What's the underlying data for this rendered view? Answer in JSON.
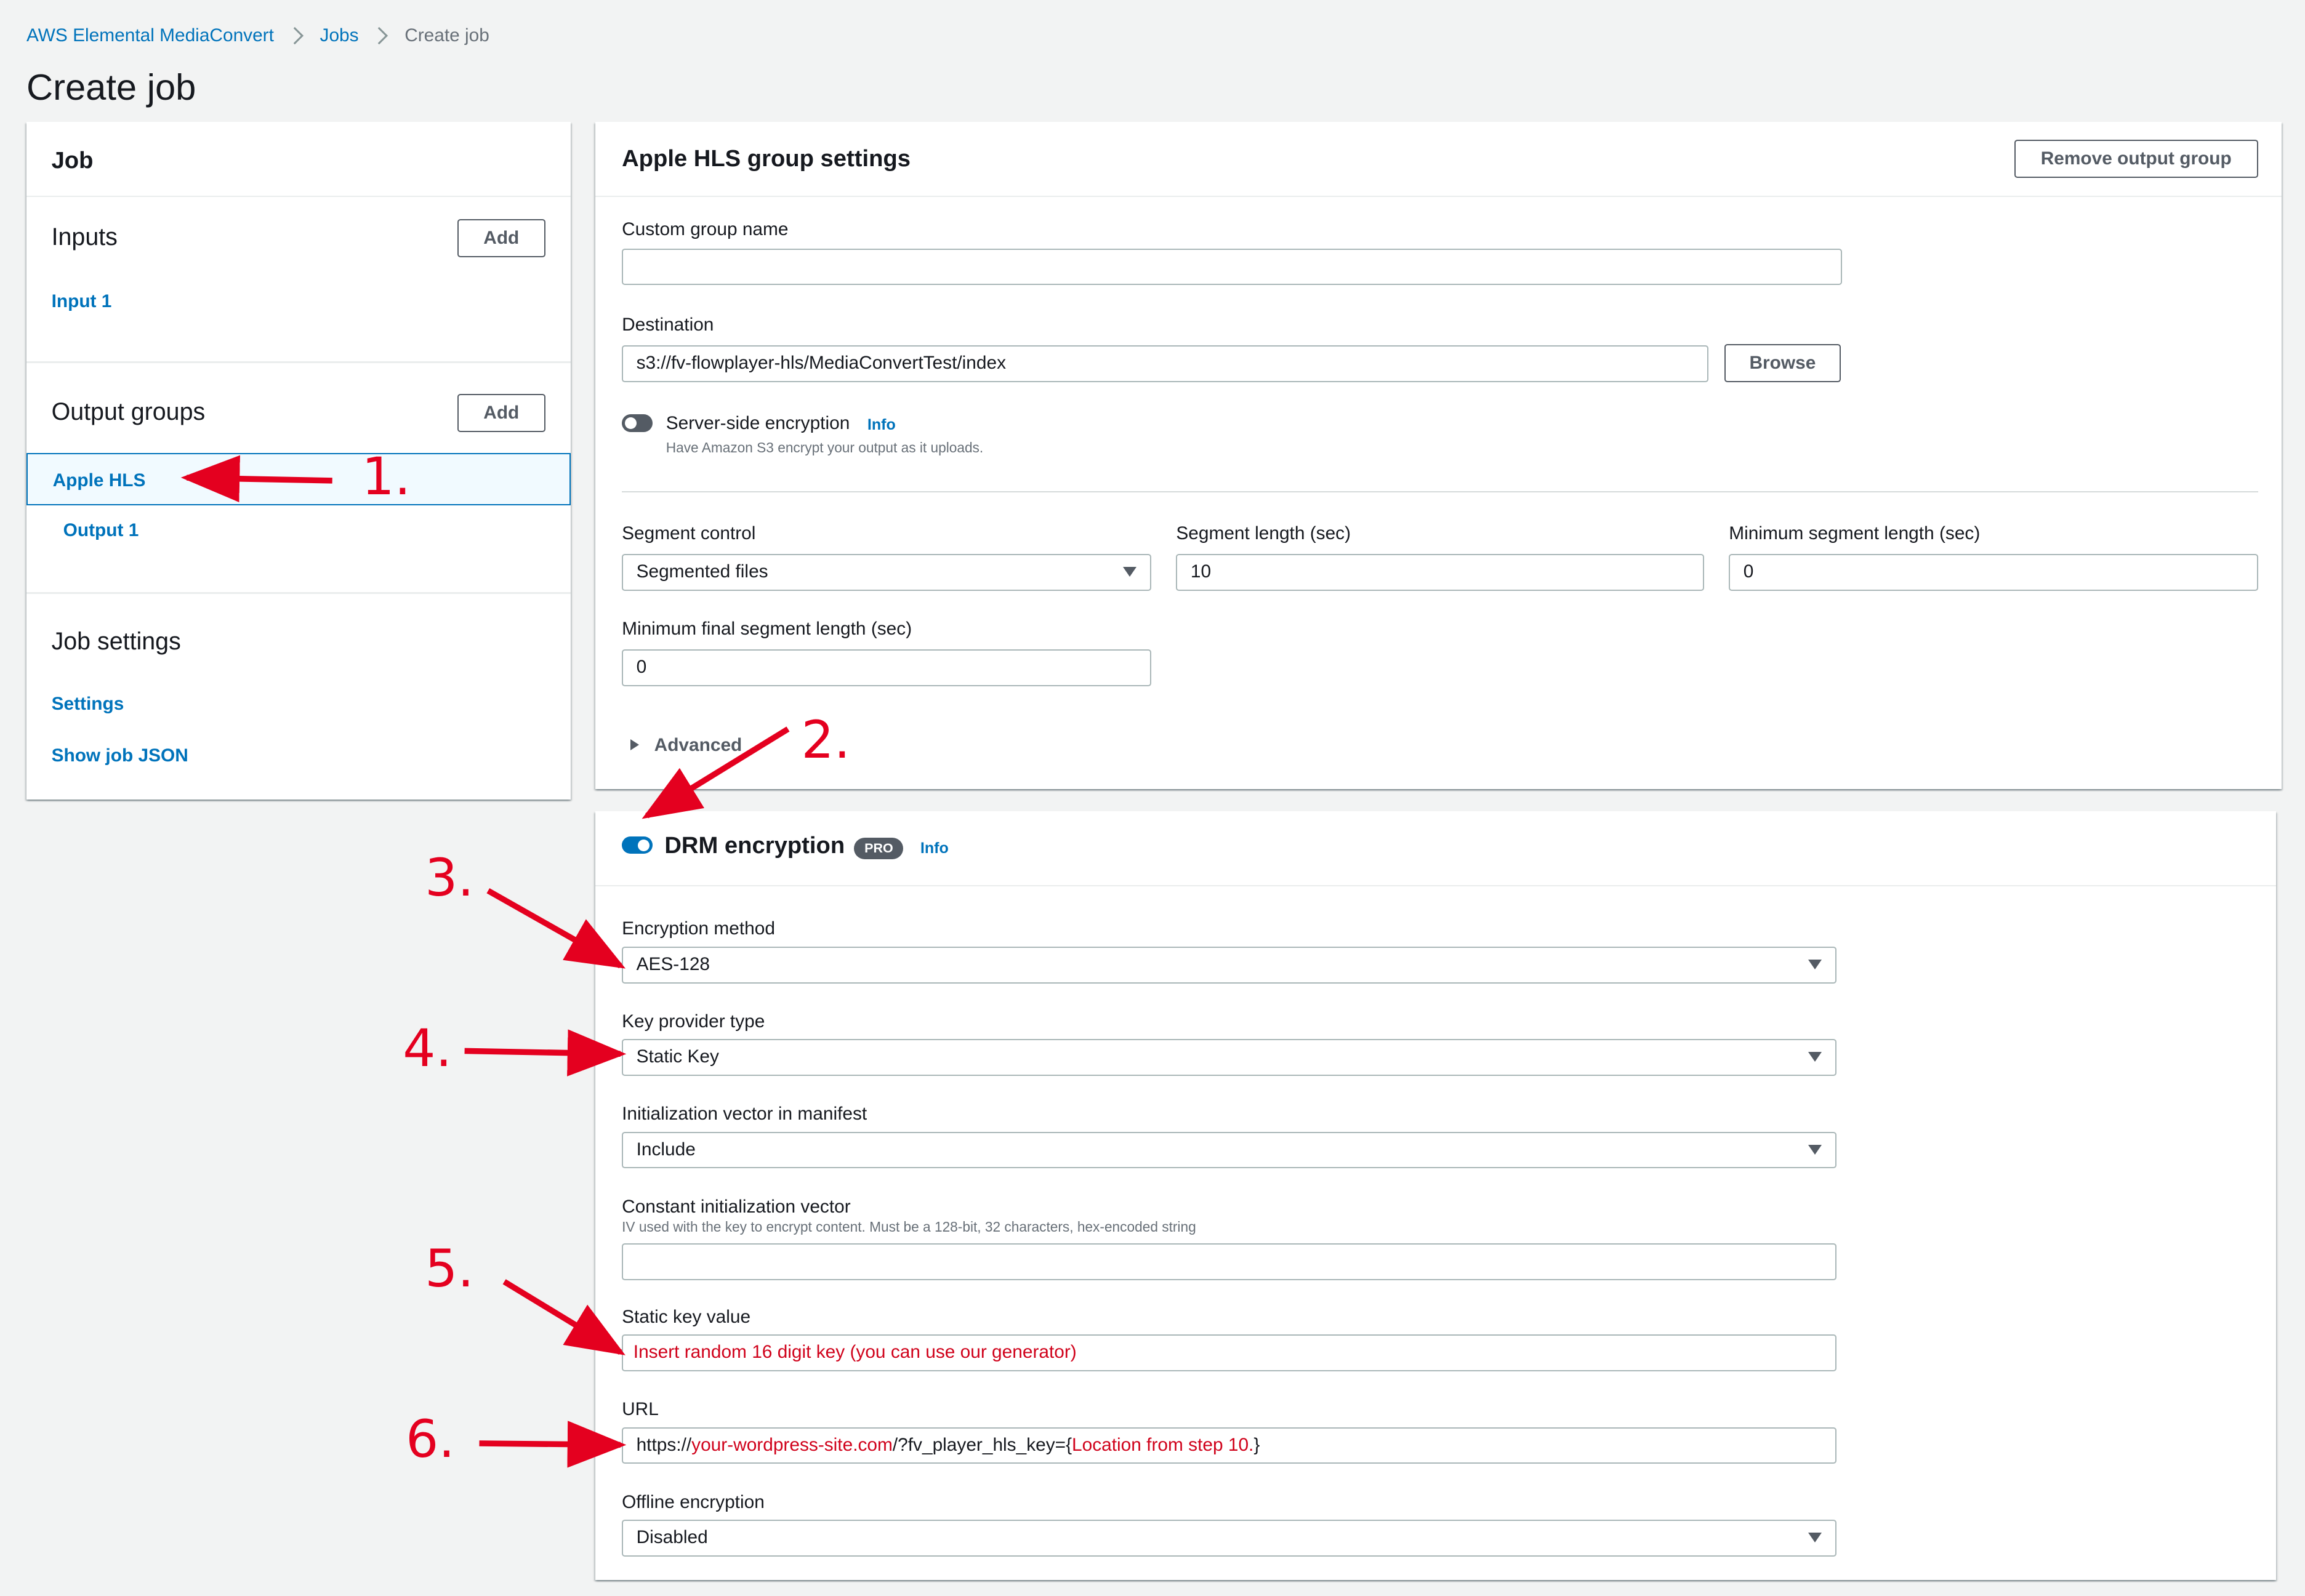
{
  "breadcrumb": {
    "service": "AWS Elemental MediaConvert",
    "jobs": "Jobs",
    "current": "Create job"
  },
  "page_title": "Create job",
  "sidebar": {
    "heading": "Job",
    "inputs": {
      "title": "Inputs",
      "add_label": "Add",
      "items": [
        "Input 1"
      ]
    },
    "output_groups": {
      "title": "Output groups",
      "add_label": "Add",
      "selected_group": "Apple HLS",
      "outputs": [
        "Output 1"
      ]
    },
    "job_settings": {
      "title": "Job settings",
      "items": [
        "Settings",
        "Show job JSON"
      ]
    }
  },
  "hls_group": {
    "title": "Apple HLS group settings",
    "remove_label": "Remove output group",
    "custom_group_name": {
      "label": "Custom group name",
      "value": ""
    },
    "destination": {
      "label": "Destination",
      "value": "s3://fv-flowplayer-hls/MediaConvertTest/index",
      "browse_label": "Browse"
    },
    "sse": {
      "label": "Server-side encryption",
      "info": "Info",
      "description": "Have Amazon S3 encrypt your output as it uploads.",
      "enabled": false
    },
    "segment_control": {
      "label": "Segment control",
      "value": "Segmented files"
    },
    "segment_length": {
      "label": "Segment length (sec)",
      "value": "10"
    },
    "min_segment_length": {
      "label": "Minimum segment length (sec)",
      "value": "0"
    },
    "min_final_segment_length": {
      "label": "Minimum final segment length (sec)",
      "value": "0"
    },
    "advanced_label": "Advanced"
  },
  "drm": {
    "title": "DRM encryption",
    "badge": "PRO",
    "info": "Info",
    "enabled": true,
    "encryption_method": {
      "label": "Encryption method",
      "value": "AES-128"
    },
    "key_provider_type": {
      "label": "Key provider type",
      "value": "Static Key"
    },
    "iv_in_manifest": {
      "label": "Initialization vector in manifest",
      "value": "Include"
    },
    "constant_iv": {
      "label": "Constant initialization vector",
      "description": "IV used with the key to encrypt content. Must be a 128-bit, 32 characters, hex-encoded string",
      "value": ""
    },
    "static_key_value": {
      "label": "Static key value",
      "value": "Insert random 16 digit key (you can use our generator)"
    },
    "url": {
      "label": "URL",
      "part1": "https://",
      "part2": "your-wordpress-site.com",
      "part3": "/?fv_player_hls_key={",
      "part4": "Location from step 10.",
      "part5": "}"
    },
    "offline_encryption": {
      "label": "Offline encryption",
      "value": "Disabled"
    }
  },
  "annotations": [
    "1.",
    "2.",
    "3.",
    "4.",
    "5.",
    "6."
  ],
  "colors": {
    "link": "#0073bb",
    "annotation": "#e4001f",
    "placeholder_red": "#d0021b"
  }
}
